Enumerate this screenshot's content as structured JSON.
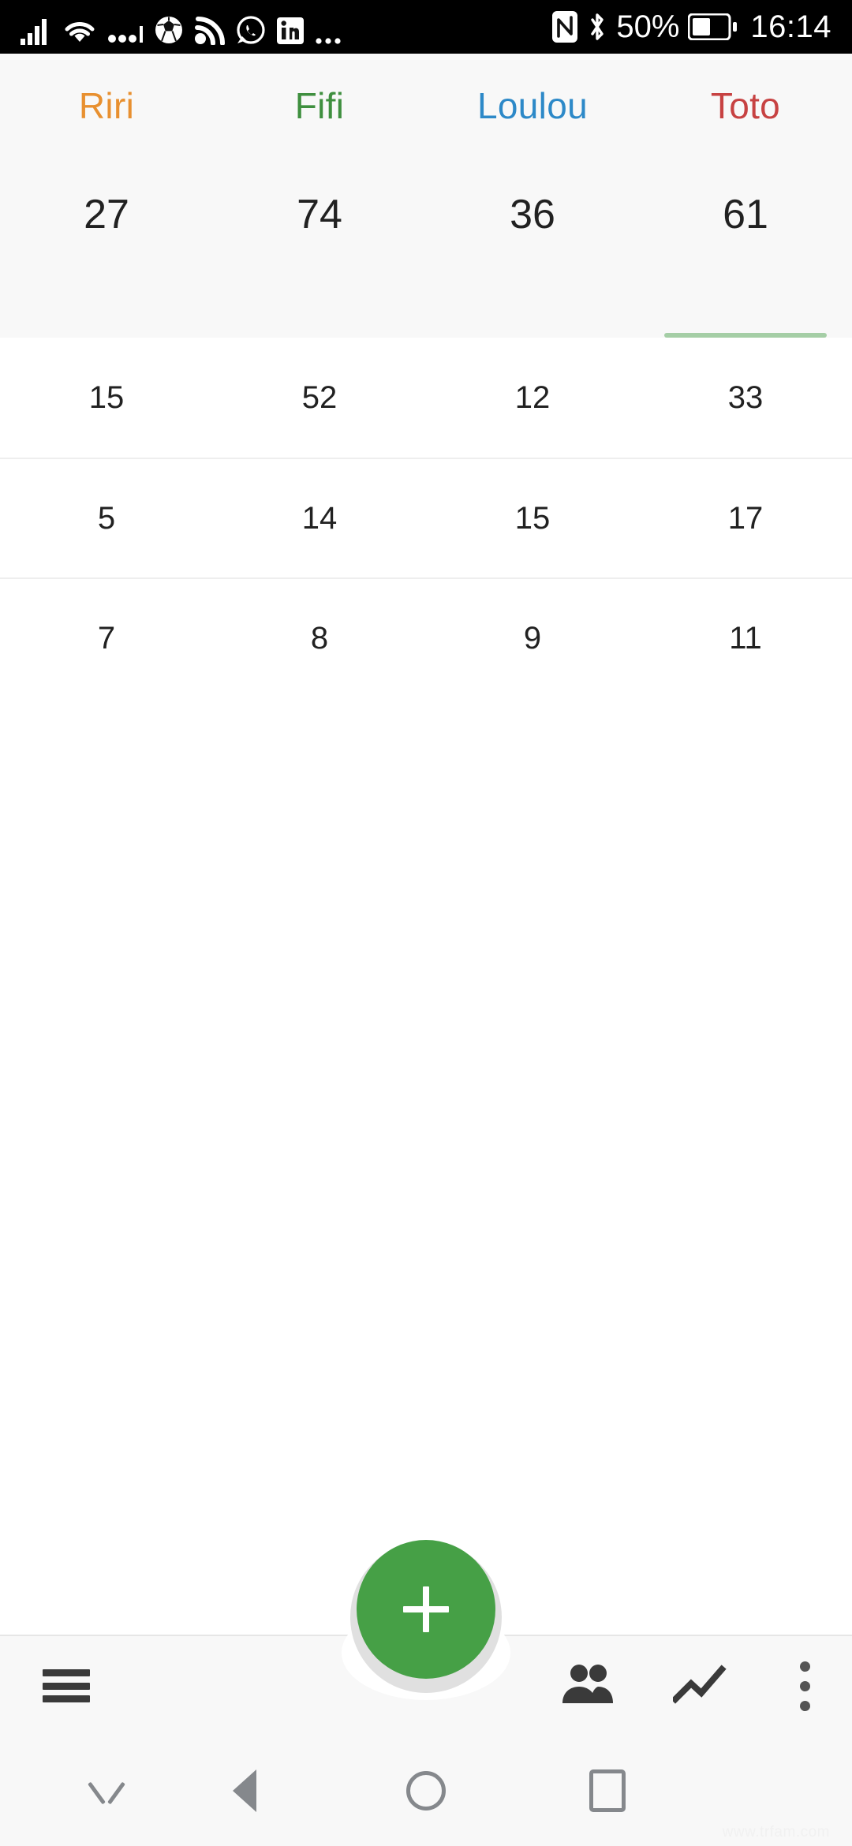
{
  "statusbar": {
    "left_icons": [
      {
        "name": "cellular-signal-icon",
        "glyph": "signal"
      },
      {
        "name": "wifi-icon",
        "glyph": "wifi"
      },
      {
        "name": "mobile-data-dots-icon",
        "glyph": "dots"
      },
      {
        "name": "soccer-ball-icon",
        "glyph": "soccer"
      },
      {
        "name": "rss-broadcast-icon",
        "glyph": "rss"
      },
      {
        "name": "whatsapp-icon",
        "glyph": "whatsapp"
      },
      {
        "name": "linkedin-icon",
        "glyph": "linkedin"
      },
      {
        "name": "more-notifications-icon",
        "glyph": "ellipsis"
      }
    ],
    "nfc_label": "NFC",
    "bluetooth_label": "Bluetooth",
    "battery_percent": "50%",
    "time": "16:14"
  },
  "tabs": [
    {
      "label": "Riri",
      "color": "#E89030",
      "active": false
    },
    {
      "label": "Fifi",
      "color": "#3F8F3F",
      "active": false
    },
    {
      "label": "Loulou",
      "color": "#2D89C8",
      "active": false
    },
    {
      "label": "Toto",
      "color": "#C74242",
      "active": true
    }
  ],
  "active_tab_indicator_color": "#A5CEA6",
  "totals": {
    "label": "totals-row",
    "values": [
      "27",
      "74",
      "36",
      "61"
    ]
  },
  "rows": [
    {
      "values": [
        "15",
        "52",
        "12",
        "33"
      ]
    },
    {
      "values": [
        "5",
        "14",
        "15",
        "17"
      ]
    },
    {
      "values": [
        "7",
        "8",
        "9",
        "11"
      ]
    }
  ],
  "fab": {
    "label": "+",
    "color": "#46A046",
    "action": "add-entry"
  },
  "bottom_bar": {
    "menu_label": "Menu",
    "people_label": "People",
    "chart_label": "Statistics",
    "more_label": "More options"
  },
  "navbar": {
    "hide_label": "Hide navigation bar",
    "back_label": "Back",
    "home_label": "Home",
    "recent_label": "Recent apps"
  },
  "watermark": "www.trfam.com"
}
